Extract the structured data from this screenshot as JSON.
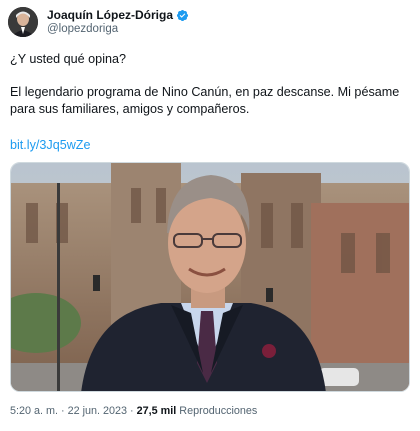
{
  "author": {
    "display_name": "Joaquín López-Dóriga",
    "handle": "@lopezdoriga",
    "verified_icon": "verified-badge-icon",
    "badge_color": "#1d9bf0"
  },
  "tweet": {
    "line1": "¿Y usted qué opina?",
    "line2": "El legendario programa de Nino Canún, en paz descanse. Mi pésame para sus familiares, amigos y compañeros.",
    "link": "bit.ly/3Jq5wZe"
  },
  "meta": {
    "time": "5:20 a. m.",
    "separator1": " · ",
    "date": "22 jun. 2023",
    "separator2": " · ",
    "views_count": "27,5 mil",
    "views_label": " Reproducciones"
  },
  "colors": {
    "link": "#1d9bf0",
    "secondary_text": "#536471",
    "primary_text": "#0f1419"
  }
}
